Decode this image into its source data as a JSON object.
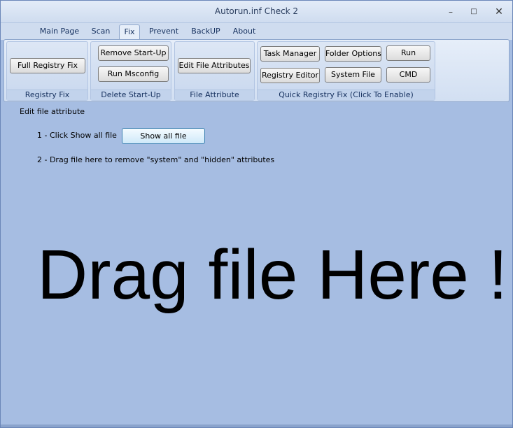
{
  "window": {
    "title": "Autorun.inf Check 2"
  },
  "titlebar_buttons": {
    "minimize": "–",
    "maximize": "□",
    "close": "✕"
  },
  "tabs": [
    {
      "label": "Main Page",
      "active": false
    },
    {
      "label": "Scan",
      "active": false
    },
    {
      "label": "Fix",
      "active": true
    },
    {
      "label": "Prevent",
      "active": false
    },
    {
      "label": "BackUP",
      "active": false
    },
    {
      "label": "About",
      "active": false
    }
  ],
  "ribbon": {
    "groups": [
      {
        "label": "Registry Fix",
        "buttons": [
          "Full Registry Fix"
        ]
      },
      {
        "label": "Delete Start-Up",
        "buttons": [
          "Remove Start-Up",
          "Run Msconfig"
        ]
      },
      {
        "label": "File Attribute",
        "buttons": [
          "Edit File Attributes"
        ]
      },
      {
        "label": "Quick Registry Fix (Click To Enable)",
        "buttons": [
          "Task Manager",
          "Folder Options",
          "Run",
          "Registry Editor",
          "System File",
          "CMD"
        ]
      }
    ]
  },
  "content": {
    "heading": "Edit file attribute",
    "step1": "1 - Click Show all file",
    "show_all_button": "Show all file",
    "step2": "2 - Drag file here to remove \"system\" and \"hidden\" attributes",
    "drop_text": "Drag file Here !"
  },
  "colors": {
    "background": "#a6bde2",
    "ribbon": "#d2dff2",
    "show_button_border": "#3c7fb1"
  }
}
